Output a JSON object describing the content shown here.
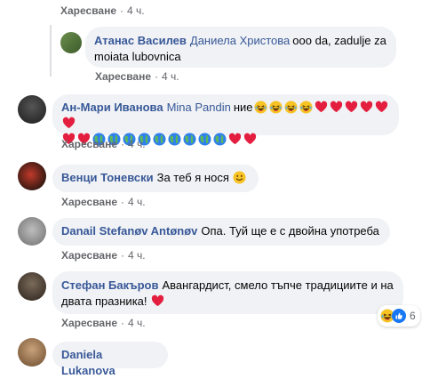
{
  "comments": [
    {
      "actions": {
        "like": "Харесване",
        "time": "4 ч."
      }
    },
    {
      "author": "Атанас Василев",
      "mention": "Даниела Христова",
      "text": "ooo da, zadulje za moiata lubovnica",
      "actions": {
        "like": "Харесване",
        "time": "4 ч."
      }
    },
    {
      "author": "Ан-Мари Иванова",
      "mention": "Mina Pandin",
      "text": "ние",
      "actions": {
        "like": "Харесване",
        "time": "4 ч."
      }
    },
    {
      "author": "Венци Тоневски",
      "text": "За теб я нося",
      "actions": {
        "like": "Харесване",
        "time": "4 ч."
      }
    },
    {
      "author": "Danail Stefanøv Antønøv",
      "text": "Опа. Туй ще е с двойна употреба",
      "actions": {
        "like": "Харесване",
        "time": "4 ч."
      }
    },
    {
      "author": "Стефан Бакъров",
      "text": "Авангардист, смело тъпче традициите и на двата празника!",
      "actions": {
        "like": "Харесване",
        "time": "4 ч."
      },
      "reaction_count": "6"
    },
    {
      "author": "Daniela Lukanova"
    }
  ],
  "colors": {
    "link": "#385898",
    "bubble": "#f0f2f5",
    "meta": "#65676b",
    "heart": "#e41e3f",
    "laugh": "#f7b125"
  },
  "icons": [
    "laughing-emoji-icon",
    "heart-emoji-icon",
    "globe-emoji-icon",
    "smile-emoji-icon",
    "like-reaction-icon"
  ]
}
